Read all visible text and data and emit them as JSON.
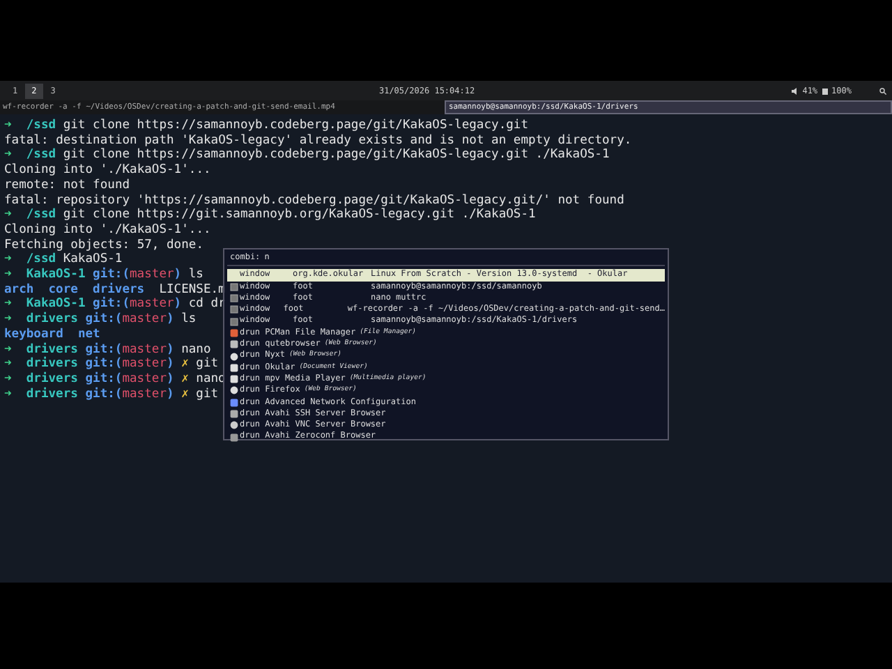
{
  "top_bar": {
    "workspaces": [
      {
        "label": "1",
        "selected": false
      },
      {
        "label": "2",
        "selected": true
      },
      {
        "label": "3",
        "selected": false
      }
    ],
    "clock": "31/05/2026 15:04:12",
    "volume": "41%",
    "battery": "100%"
  },
  "window_tabs": [
    {
      "title": "wf-recorder -a -f ~/Videos/OSDev/creating-a-patch-and-git-send-email.mp4",
      "selected": false
    },
    {
      "title": "samannoyb@samannoyb:/ssd/KakaOS-1/drivers",
      "selected": true
    }
  ],
  "terminal": {
    "lines": [
      [
        {
          "text": "➜",
          "kind": "arrow"
        },
        {
          "text": "/ssd",
          "kind": "dir"
        },
        {
          "text": "git clone https://samannoyb.codeberg.page/git/KakaOS-legacy.git",
          "kind": "plain"
        }
      ],
      [
        {
          "text": "fatal: destination path 'KakaOS-legacy' already exists and is not an empty directory.",
          "kind": "plain"
        }
      ],
      [
        {
          "text": "➜",
          "kind": "arrow"
        },
        {
          "text": "/ssd",
          "kind": "dir"
        },
        {
          "text": "git clone https://samannoyb.codeberg.page/git/KakaOS-legacy.git ./KakaOS-1",
          "kind": "plain"
        }
      ],
      [
        {
          "text": "Cloning into './KakaOS-1'...",
          "kind": "plain"
        }
      ],
      [
        {
          "text": "remote: not found",
          "kind": "plain"
        }
      ],
      [
        {
          "text": "fatal: repository 'https://samannoyb.codeberg.page/git/KakaOS-legacy.git/' not found",
          "kind": "plain"
        }
      ],
      [
        {
          "text": "➜",
          "kind": "arrow"
        },
        {
          "text": "/ssd",
          "kind": "dir"
        },
        {
          "text": "git clone https://git.samannoyb.org/KakaOS-legacy.git ./KakaOS-1",
          "kind": "plain"
        }
      ],
      [
        {
          "text": "Cloning into './KakaOS-1'...",
          "kind": "plain"
        }
      ],
      [
        {
          "text": "Fetching objects: 57, done.",
          "kind": "plain"
        }
      ],
      [
        {
          "text": "➜",
          "kind": "arrow"
        },
        {
          "text": "/ssd",
          "kind": "dir"
        },
        {
          "text": "KakaOS-1",
          "kind": "plain"
        }
      ],
      [
        {
          "text": "➜",
          "kind": "arrow"
        },
        {
          "text": "KakaOS-1",
          "kind": "dir"
        },
        {
          "text": "git:(",
          "kind": "git_open"
        },
        {
          "text": "master",
          "kind": "branch"
        },
        {
          "text": ")",
          "kind": "git_close"
        },
        {
          "text": "ls",
          "kind": "plain"
        }
      ],
      [
        {
          "text": "arch",
          "kind": "folder"
        },
        {
          "text": "core",
          "kind": "folder"
        },
        {
          "text": "drivers",
          "kind": "folder"
        },
        {
          "text": "LICENSE.m",
          "kind": "file"
        }
      ],
      [
        {
          "text": "➜",
          "kind": "arrow"
        },
        {
          "text": "KakaOS-1",
          "kind": "dir"
        },
        {
          "text": "git:(",
          "kind": "git_open"
        },
        {
          "text": "master",
          "kind": "branch"
        },
        {
          "text": ")",
          "kind": "git_close"
        },
        {
          "text": "cd dr",
          "kind": "plain"
        }
      ],
      [
        {
          "text": "➜",
          "kind": "arrow"
        },
        {
          "text": "drivers",
          "kind": "dir"
        },
        {
          "text": "git:(",
          "kind": "git_open"
        },
        {
          "text": "master",
          "kind": "branch"
        },
        {
          "text": ")",
          "kind": "git_close"
        },
        {
          "text": "ls",
          "kind": "plain"
        }
      ],
      [
        {
          "text": "keyboard",
          "kind": "folder"
        },
        {
          "text": "net",
          "kind": "folder"
        }
      ],
      [
        {
          "text": "➜",
          "kind": "arrow"
        },
        {
          "text": "drivers",
          "kind": "dir"
        },
        {
          "text": "git:(",
          "kind": "git_open"
        },
        {
          "text": "master",
          "kind": "branch"
        },
        {
          "text": ")",
          "kind": "git_close"
        },
        {
          "text": "nano",
          "kind": "plain"
        }
      ],
      [
        {
          "text": "➜",
          "kind": "arrow"
        },
        {
          "text": "drivers",
          "kind": "dir"
        },
        {
          "text": "git:(",
          "kind": "git_open"
        },
        {
          "text": "master",
          "kind": "branch"
        },
        {
          "text": ")",
          "kind": "git_close"
        },
        {
          "text": "✗",
          "kind": "dirty"
        },
        {
          "text": "git",
          "kind": "plain"
        }
      ],
      [
        {
          "text": "➜",
          "kind": "arrow"
        },
        {
          "text": "drivers",
          "kind": "dir"
        },
        {
          "text": "git:(",
          "kind": "git_open"
        },
        {
          "text": "master",
          "kind": "branch"
        },
        {
          "text": ")",
          "kind": "git_close"
        },
        {
          "text": "✗",
          "kind": "dirty"
        },
        {
          "text": "nano",
          "kind": "plain"
        }
      ],
      [
        {
          "text": "➜",
          "kind": "arrow"
        },
        {
          "text": "drivers",
          "kind": "dir"
        },
        {
          "text": "git:(",
          "kind": "git_open"
        },
        {
          "text": "master",
          "kind": "branch"
        },
        {
          "text": ")",
          "kind": "git_close"
        },
        {
          "text": "✗",
          "kind": "dirty"
        },
        {
          "text": "git",
          "kind": "plain"
        }
      ]
    ]
  },
  "launcher": {
    "prompt": "combi:",
    "value": "n",
    "entries": [
      {
        "kind": "window",
        "app": "org.kde.okular",
        "title": "Linux From Scratch - Version 13.0-systemd  - Okular",
        "selected": true
      },
      {
        "kind": "window",
        "app": "foot",
        "title": "samannoyb@samannoyb:/ssd/samannoyb",
        "selected": false
      },
      {
        "kind": "window",
        "app": "foot",
        "title": "nano muttrc",
        "selected": false
      },
      {
        "kind": "window",
        "app": "foot",
        "title": "wf-recorder -a -f ~/Videos/OSDev/creating-a-patch-and-git-send…",
        "selected": false
      },
      {
        "kind": "window",
        "app": "foot",
        "title": "samannoyb@samannoyb:/ssd/KakaOS-1/drivers",
        "selected": false
      },
      {
        "kind": "drun",
        "name": "PCMan File Manager",
        "description": "(File Manager)",
        "selected": false
      },
      {
        "kind": "drun",
        "name": "qutebrowser",
        "description": "(Web Browser)",
        "selected": false
      },
      {
        "kind": "drun",
        "name": "Nyxt",
        "description": "(Web Browser)",
        "selected": false
      },
      {
        "kind": "drun",
        "name": "Okular",
        "description": "(Document Viewer)",
        "selected": false
      },
      {
        "kind": "drun",
        "name": "mpv Media Player",
        "description": "(Multimedia player)",
        "selected": false
      },
      {
        "kind": "drun",
        "name": "Firefox",
        "description": "(Web Browser)",
        "selected": false
      },
      {
        "kind": "drun",
        "name": "Advanced Network Configuration",
        "selected": false
      },
      {
        "kind": "drun",
        "name": "Avahi SSH Server Browser",
        "selected": false
      },
      {
        "kind": "drun",
        "name": "Avahi VNC Server Browser",
        "selected": false
      },
      {
        "kind": "drun",
        "name": "Avahi Zeroconf Browser",
        "selected": false
      }
    ]
  }
}
